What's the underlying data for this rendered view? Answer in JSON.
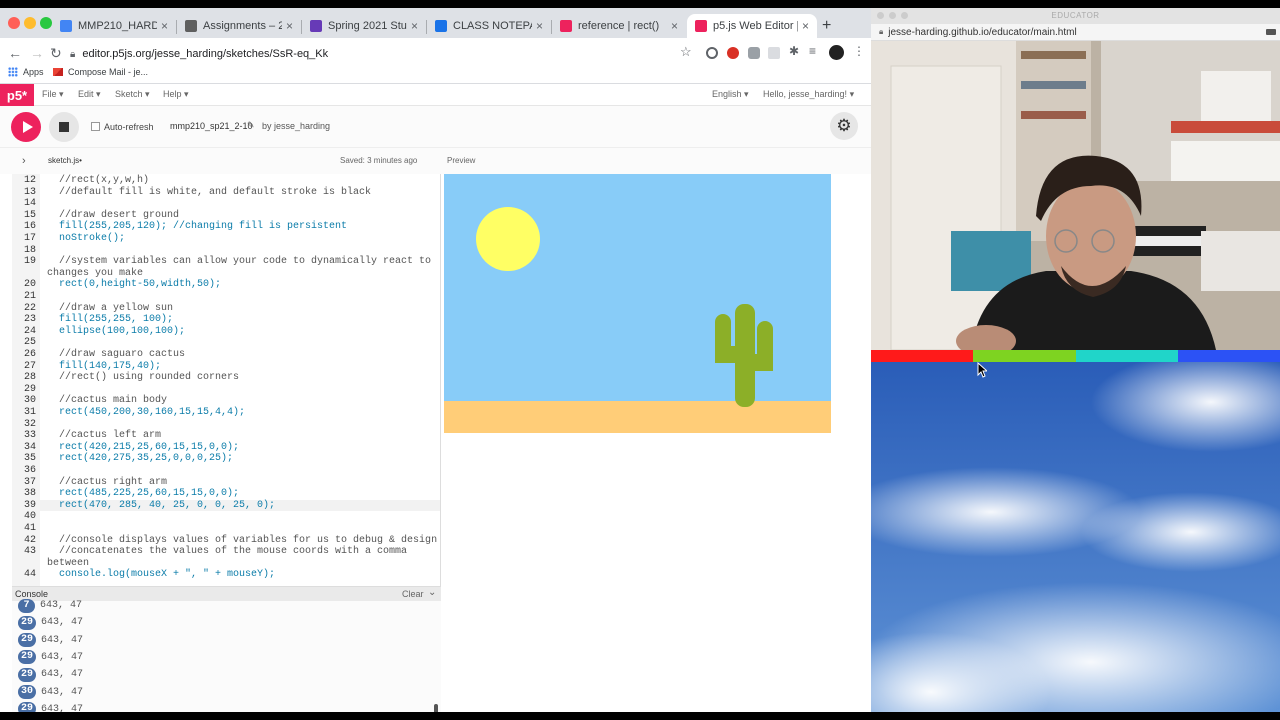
{
  "browser": {
    "tabs": [
      {
        "title": "MMP210_HARDING_SP",
        "favicon_color": "#4285f4",
        "active": false
      },
      {
        "title": "Assignments – 2021 Sp",
        "favicon_color": "#5f5f5f",
        "active": false
      },
      {
        "title": "Spring 2021 Student Su",
        "favicon_color": "#673ab7",
        "active": false
      },
      {
        "title": "CLASS NOTEPAD MMP",
        "favicon_color": "#1a73e8",
        "active": false
      },
      {
        "title": "reference | rect()",
        "favicon_color": "#ed225d",
        "active": false
      },
      {
        "title": "p5.js Web Editor | mmp",
        "favicon_color": "#ed225d",
        "active": true
      }
    ],
    "tab_close_glyph": "×",
    "new_tab_glyph": "+",
    "url": "editor.p5js.org/jesse_harding/sketches/SsR-eq_Kk",
    "bookmarks": [
      {
        "label": "Apps",
        "icon": "apps-grid-icon"
      },
      {
        "label": "Compose Mail - je...",
        "icon": "gmail-icon"
      }
    ]
  },
  "p5": {
    "logo": "p5*",
    "menus": [
      "File",
      "Edit",
      "Sketch",
      "Help"
    ],
    "language": "English",
    "greeting": "Hello, jesse_harding!",
    "auto_refresh_label": "Auto-refresh",
    "auto_refresh_checked": false,
    "sketch_name": "mmp210_sp21_2-10",
    "author": "by jesse_harding",
    "file_name": "sketch.js",
    "file_modified_marker": "•",
    "saved_status": "Saved: 3 minutes ago",
    "preview_label": "Preview",
    "console_label": "Console",
    "console_clear": "Clear",
    "accent_color": "#ed225d"
  },
  "code_lines": [
    {
      "ln": "12",
      "text": "  //rect(x,y,w,h)",
      "kind": "cmt"
    },
    {
      "ln": "13",
      "text": "  //default fill is white, and default stroke is black",
      "kind": "cmt"
    },
    {
      "ln": "14",
      "text": "",
      "kind": "pl"
    },
    {
      "ln": "15",
      "text": "  //draw desert ground",
      "kind": "cmt"
    },
    {
      "ln": "16",
      "text": "  fill(255,205,120); //changing fill is persistent",
      "kind": "fn"
    },
    {
      "ln": "17",
      "text": "  noStroke();",
      "kind": "fn"
    },
    {
      "ln": "18",
      "text": "",
      "kind": "pl"
    },
    {
      "ln": "19",
      "text": "  //system variables can allow your code to dynamically react to",
      "kind": "cmt"
    },
    {
      "ln": "",
      "text": "changes you make",
      "kind": "cmt"
    },
    {
      "ln": "20",
      "text": "  rect(0,height-50,width,50);",
      "kind": "fn"
    },
    {
      "ln": "21",
      "text": "",
      "kind": "pl"
    },
    {
      "ln": "22",
      "text": "  //draw a yellow sun",
      "kind": "cmt"
    },
    {
      "ln": "23",
      "text": "  fill(255,255, 100);",
      "kind": "fn"
    },
    {
      "ln": "24",
      "text": "  ellipse(100,100,100);",
      "kind": "fn"
    },
    {
      "ln": "25",
      "text": "",
      "kind": "pl"
    },
    {
      "ln": "26",
      "text": "  //draw saguaro cactus",
      "kind": "cmt"
    },
    {
      "ln": "27",
      "text": "  fill(140,175,40);",
      "kind": "fn"
    },
    {
      "ln": "28",
      "text": "  //rect() using rounded corners",
      "kind": "cmt"
    },
    {
      "ln": "29",
      "text": "",
      "kind": "pl"
    },
    {
      "ln": "30",
      "text": "  //cactus main body",
      "kind": "cmt"
    },
    {
      "ln": "31",
      "text": "  rect(450,200,30,160,15,15,4,4);",
      "kind": "fn"
    },
    {
      "ln": "32",
      "text": "",
      "kind": "pl"
    },
    {
      "ln": "33",
      "text": "  //cactus left arm",
      "kind": "cmt"
    },
    {
      "ln": "34",
      "text": "  rect(420,215,25,60,15,15,0,0);",
      "kind": "fn"
    },
    {
      "ln": "35",
      "text": "  rect(420,275,35,25,0,0,0,25);",
      "kind": "fn"
    },
    {
      "ln": "36",
      "text": "",
      "kind": "pl"
    },
    {
      "ln": "37",
      "text": "  //cactus right arm",
      "kind": "cmt"
    },
    {
      "ln": "38",
      "text": "  rect(485,225,25,60,15,15,0,0);",
      "kind": "fn"
    },
    {
      "ln": "39",
      "text": "  rect(470, 285, 40, 25, 0, 0, 25, 0);",
      "kind": "fn",
      "active": true
    },
    {
      "ln": "40",
      "text": "",
      "kind": "pl"
    },
    {
      "ln": "41",
      "text": "",
      "kind": "pl"
    },
    {
      "ln": "42",
      "text": "  //console displays values of variables for us to debug & design",
      "kind": "cmt"
    },
    {
      "ln": "43",
      "text": "  //concatenates the values of the mouse coords with a comma",
      "kind": "cmt"
    },
    {
      "ln": "",
      "text": "between",
      "kind": "cmt"
    },
    {
      "ln": "44",
      "text": "  console.log(mouseX + \", \" + mouseY);",
      "kind": "fn"
    }
  ],
  "console_lines": [
    {
      "count": "7",
      "text": "643, 47"
    },
    {
      "count": "29",
      "text": "643, 47"
    },
    {
      "count": "29",
      "text": "643, 47"
    },
    {
      "count": "29",
      "text": "643, 47"
    },
    {
      "count": "29",
      "text": "643, 47"
    },
    {
      "count": "30",
      "text": "643, 47"
    },
    {
      "count": "29",
      "text": "643, 47"
    }
  ],
  "sketch_colors": {
    "sky": "#88ccf8",
    "ground": "#ffcd78",
    "sun": "#ffff64",
    "cactus": "#8caf28"
  },
  "educator": {
    "window_title": "EDUCATOR",
    "url": "jesse-harding.github.io/educator/main.html",
    "color_bar": [
      "#ff1a1a",
      "#7ed321",
      "#20d5c9",
      "#2c52f5"
    ]
  }
}
